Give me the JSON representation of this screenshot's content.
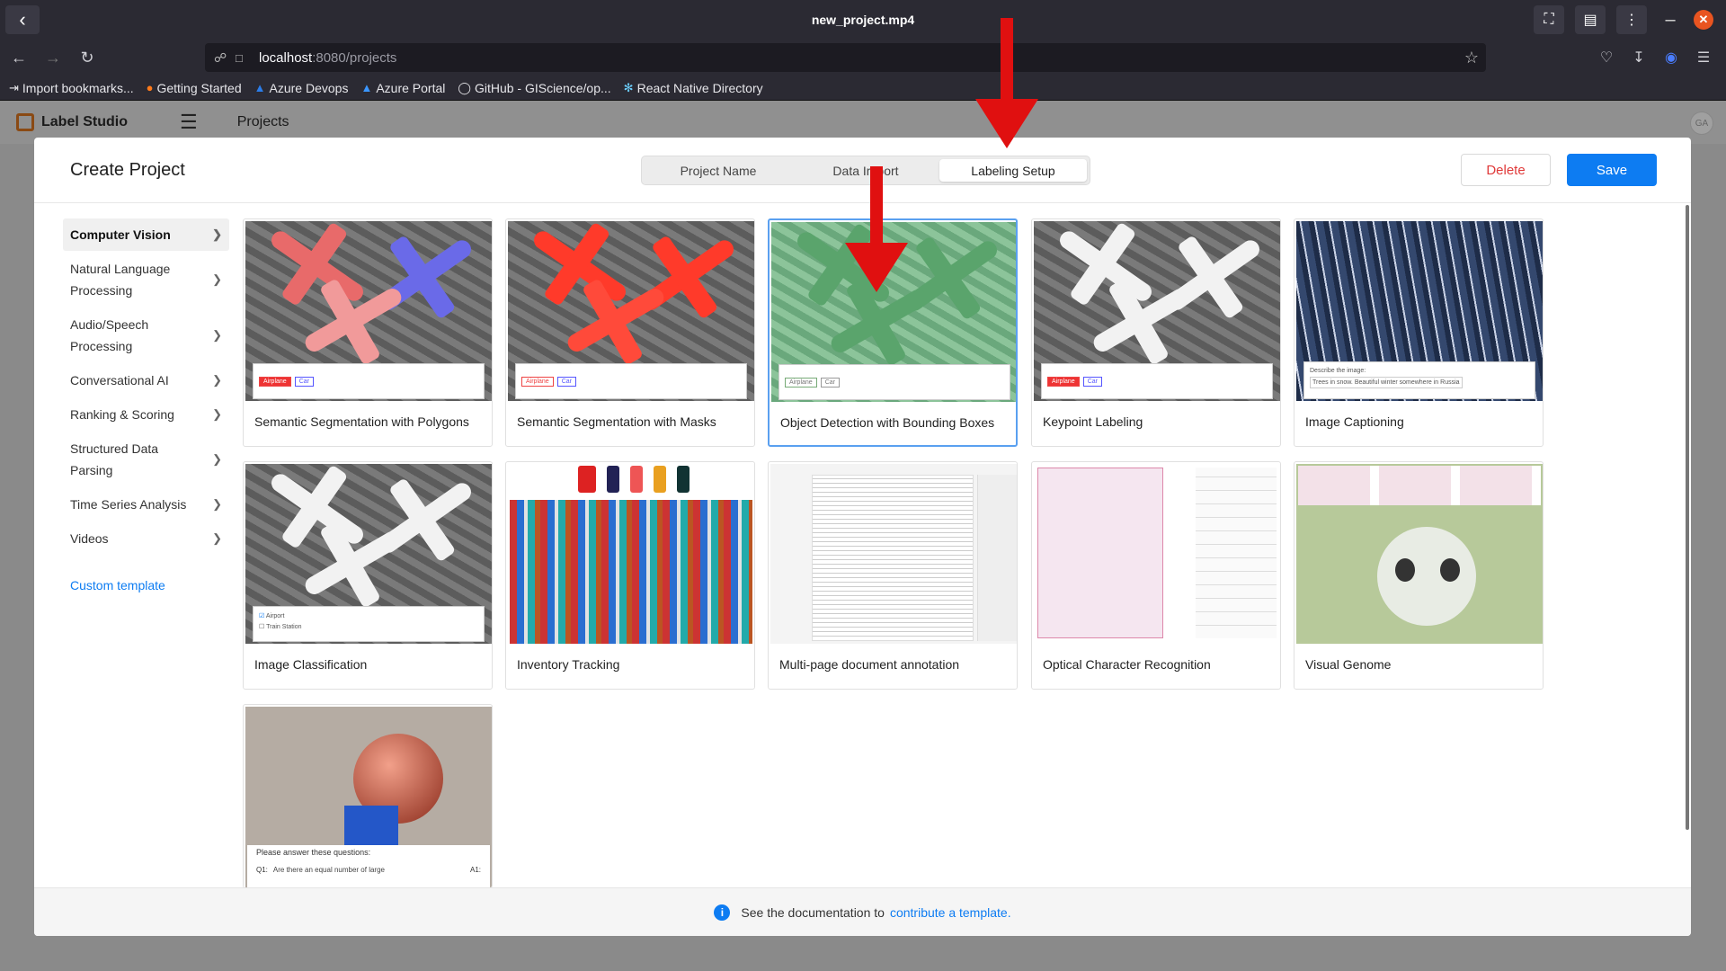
{
  "player": {
    "title": "new_project.mp4"
  },
  "browser": {
    "url_host": "localhost",
    "url_path": ":8080/projects",
    "bookmarks": [
      {
        "label": "Import bookmarks...",
        "icon": "import-icon"
      },
      {
        "label": "Getting Started",
        "icon": "firefox-icon"
      },
      {
        "label": "Azure Devops",
        "icon": "azure-devops-icon"
      },
      {
        "label": "Azure Portal",
        "icon": "azure-icon"
      },
      {
        "label": "GitHub - GIScience/op...",
        "icon": "github-icon"
      },
      {
        "label": "React Native Directory",
        "icon": "react-icon"
      }
    ]
  },
  "app": {
    "name": "Label Studio",
    "nav_title": "Projects",
    "avatar": "GA"
  },
  "modal": {
    "title": "Create Project",
    "tabs": [
      "Project Name",
      "Data Import",
      "Labeling Setup"
    ],
    "active_tab": "Labeling Setup",
    "delete_label": "Delete",
    "save_label": "Save"
  },
  "sidebar": {
    "items": [
      {
        "label": "Computer Vision",
        "active": true
      },
      {
        "label": "Natural Language Processing"
      },
      {
        "label": "Audio/Speech Processing"
      },
      {
        "label": "Conversational AI"
      },
      {
        "label": "Ranking & Scoring"
      },
      {
        "label": "Structured Data Parsing"
      },
      {
        "label": "Time Series Analysis"
      },
      {
        "label": "Videos"
      }
    ],
    "custom": "Custom template"
  },
  "templates": [
    {
      "title": "Semantic Segmentation with Polygons",
      "tags": [
        "Airplane",
        "Car"
      ]
    },
    {
      "title": "Semantic Segmentation with Masks",
      "tags": [
        "Airplane",
        "Car"
      ]
    },
    {
      "title": "Object Detection with Bounding Boxes",
      "tags": [
        "Airplane",
        "Car"
      ],
      "selected": true
    },
    {
      "title": "Keypoint Labeling",
      "tags": [
        "Airplane",
        "Car"
      ]
    },
    {
      "title": "Image Captioning",
      "caption_q": "Describe the image:",
      "caption_a": "Trees in snow. Beautiful winter somewhere in Russia"
    },
    {
      "title": "Image Classification",
      "options": [
        "Airport",
        "Train Station"
      ]
    },
    {
      "title": "Inventory Tracking"
    },
    {
      "title": "Multi-page document annotation"
    },
    {
      "title": "Optical Character Recognition"
    },
    {
      "title": "Visual Genome"
    },
    {
      "title": "",
      "qa_title": "Please answer these questions:",
      "q1": "Q1:",
      "q1_text": "Are there an equal number of large",
      "a1": "A1:"
    }
  ],
  "footer": {
    "text": "See the documentation to",
    "link": "contribute a template."
  },
  "colors": {
    "accent": "#0d7cf2",
    "danger": "#e03a3a",
    "arrow": "#e01010"
  }
}
